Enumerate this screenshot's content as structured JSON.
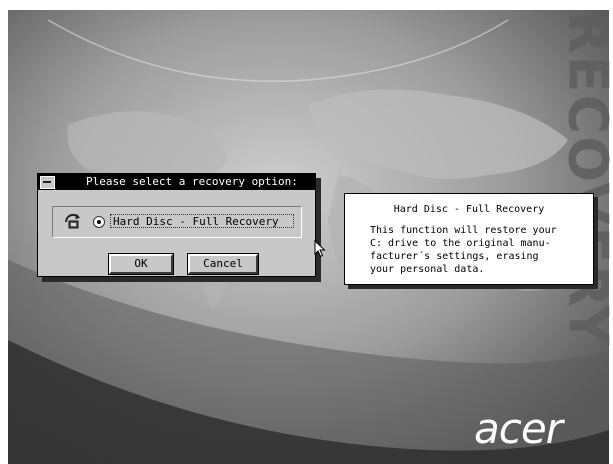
{
  "wallpaper": {
    "watermark": "RECOVERY",
    "brand_logo": "acer"
  },
  "dialog": {
    "title": "Please select a recovery option:",
    "options": [
      {
        "label": "Hard Disc - Full Recovery",
        "selected": true
      }
    ],
    "ok_label": "OK",
    "cancel_label": "Cancel"
  },
  "info": {
    "title": "Hard Disc - Full Recovery",
    "body": "This function will restore your\nC: drive to the original manu-\nfacturer´s settings, erasing\nyour personal data."
  }
}
